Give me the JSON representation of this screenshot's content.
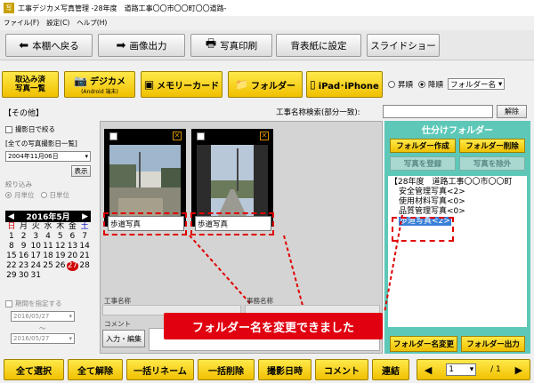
{
  "window": {
    "logo": "写",
    "title": "工事デジカメ写真管理 -28年度　道路工事〇〇市〇〇町〇〇道路-"
  },
  "menu": [
    "ファイル(F)",
    "設定(C)",
    "ヘルプ(H)"
  ],
  "toolbar1": {
    "back": "本棚へ戻る",
    "image_output": "画像出力",
    "print": "写真印刷",
    "spine": "背表紙に設定",
    "slideshow": "スライドショー"
  },
  "toolbar2": {
    "imported": "取込み済\n写真一覧",
    "camera": "デジカメ",
    "camera_sub": "(Android 端末)",
    "memory": "メモリーカード",
    "folder": "フォルダー",
    "ipad": "iPad･iPhone",
    "asc": "昇順",
    "desc": "降順",
    "sort_value": "フォルダー名"
  },
  "category": "【その他】",
  "search": {
    "label": "工事名称検索(部分一致):",
    "value": "",
    "clear": "解除"
  },
  "left": {
    "date_filter": "撮影日で絞る",
    "all_dates": "[全ての写真撮影日一覧]",
    "date_value": "2004年11月06日",
    "show": "表示",
    "narrow": "絞り込み",
    "by_month": "月単位",
    "by_day": "日単位",
    "calendar_title": "2016年5月",
    "weekdays": [
      "日",
      "月",
      "火",
      "水",
      "木",
      "金",
      "土"
    ],
    "period": "期間を指定する",
    "from": "2016/05/27",
    "tilde": "〜",
    "to": "2016/05/27"
  },
  "photos": [
    {
      "caption": "歩道写真"
    },
    {
      "caption": "歩道写真"
    }
  ],
  "center_fields": {
    "work_name": "工事名称",
    "office_name": "事務名称",
    "comment": "コメント",
    "edit": "入力・編集"
  },
  "banner": "フォルダー名を変更できました",
  "right": {
    "title": "仕分けフォルダー",
    "create": "フォルダー作成",
    "delete": "フォルダー削除",
    "register": "写真を登録",
    "exclude": "写真を除外",
    "tree": [
      "【28年度　道路工事〇〇市〇〇町",
      "安全管理写真<2>",
      "使用材料写真<0>",
      "品質管理写真<0>",
      "歩道写真<2>"
    ],
    "rename": "フォルダー名変更",
    "output": "フォルダー出力"
  },
  "bottom": {
    "select_all": "全て選択",
    "deselect_all": "全て解除",
    "bulk_rename": "一括リネーム",
    "bulk_delete": "一括削除",
    "shot_date": "撮影日時",
    "comment": "コメント",
    "join": "連結",
    "page": "1",
    "page_total": "/ 1"
  },
  "colors": {
    "yellow": "#f5d000",
    "teal": "#5ec8b8",
    "red": "#e00010",
    "select": "#3a7fd8"
  }
}
